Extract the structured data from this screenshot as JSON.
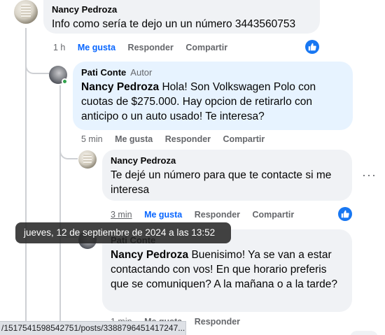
{
  "comments": [
    {
      "author": "Nancy Pedroza",
      "text": "Info como sería te dejo un un número 3443560753",
      "time": "1 h",
      "like": "Me gusta",
      "reply": "Responder",
      "share": "Compartir"
    },
    {
      "author": "Pati Conte",
      "badge": "Autor",
      "mention": "Nancy Pedroza",
      "text": " Hola! Son Volkswagen Polo con cuotas de $275.000. Hay opcion de retirarlo con anticipo o un auto usado! Te interesa?",
      "time": "5 min",
      "like": "Me gusta",
      "reply": "Responder",
      "share": "Compartir"
    },
    {
      "author": "Nancy Pedroza",
      "text": "Te dejé un número para que te contacte si me interesa",
      "time": "3 min",
      "like": "Me gusta",
      "reply": "Responder",
      "share": "Compartir"
    },
    {
      "author": "Pati Conte",
      "mention": "Nancy Pedroza",
      "text": " Buenisimo! Ya se van a estar contactando con vos! En que horario preferis que se comuniquen? A la mañana o a la tarde?",
      "time": "1 min",
      "like": "Me gusta",
      "reply": "Responder"
    }
  ],
  "tooltip": "jueves, 12 de septiembre de 2024 a las 13:52",
  "status_url": "/1517541598542751/posts/3388796451417247...",
  "colors": {
    "accent": "#0866ff",
    "bubble": "#f0f2f5",
    "highlight": "#e7f3ff",
    "secondary_text": "#65676b",
    "online": "#31a24c"
  },
  "icons": [
    "avatar-nancy",
    "avatar-pati",
    "like-reaction-icon",
    "more-options-icon"
  ]
}
